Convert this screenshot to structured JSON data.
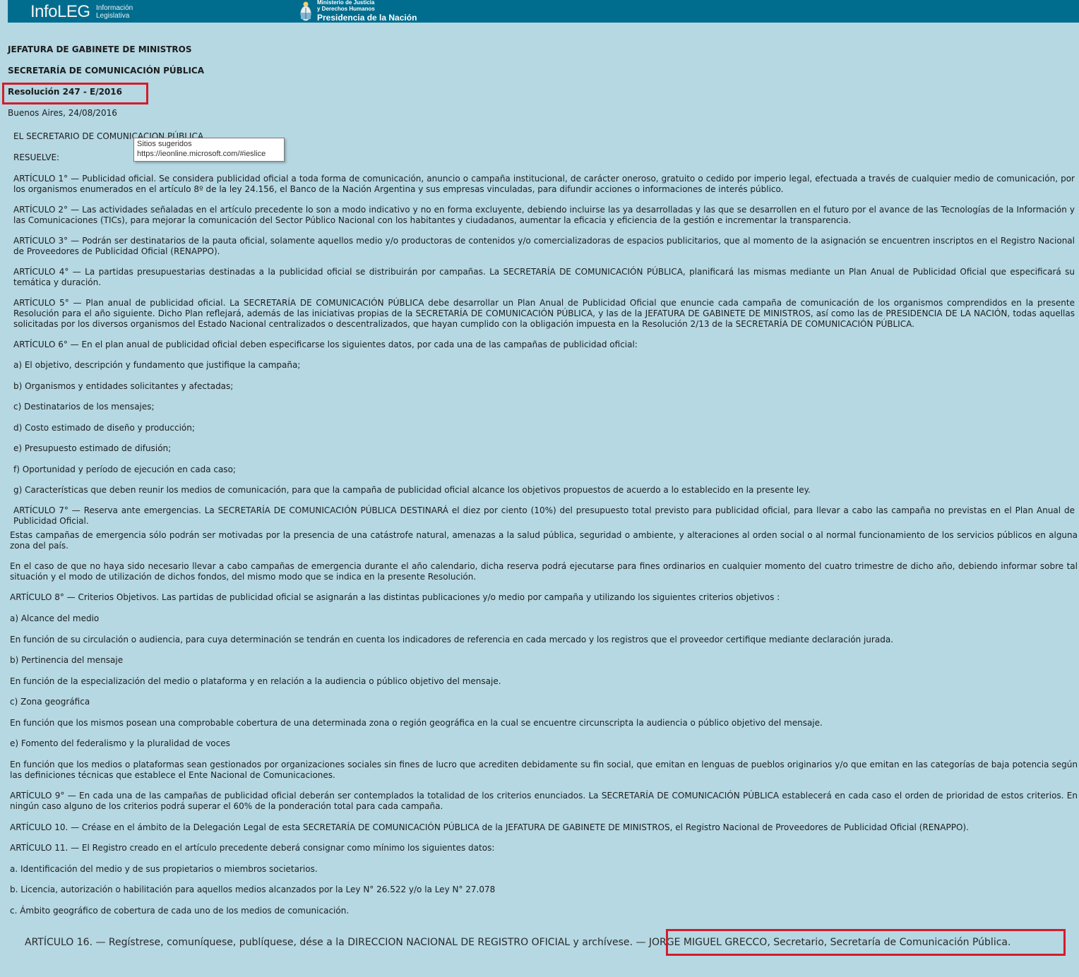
{
  "header": {
    "logo_main": "InfoLEG",
    "logo_sub_1": "Información",
    "logo_sub_2": "Legislativa",
    "ministry_1": "Ministerio de Justicia",
    "ministry_2": "y Derechos Humanos",
    "ministry_3": "Presidencia de la Nación",
    "bg_color": "#006d8f"
  },
  "doc": {
    "org1": "JEFATURA DE GABINETE DE MINISTROS",
    "org2": "SECRETARÍA DE COMUNICACIÓN PÚBLICA",
    "resolution": "Resolución 247 - E/2016",
    "place_date": "Buenos Aires, 24/08/2016",
    "lines": [
      "EL SECRETARIO DE COMUNICACION PÚBLICA",
      "RESUELVE:",
      "ARTÍCULO 1° — Publicidad oficial. Se considera publicidad oficial a toda forma de comunicación, anuncio o campaña institucional, de carácter oneroso, gratuito o cedido por imperio legal, efectuada a través de cualquier medio de comunicación, por los organismos enumerados en el artículo 8º de la ley 24.156, el Banco de la Nación Argentina y sus empresas vinculadas, para difundir acciones o informaciones de interés público.",
      "ARTÍCULO 2° — Las actividades señaladas en el artículo precedente lo son a modo indicativo y no en forma excluyente, debiendo incluirse las ya desarrolladas y las que se desarrollen en el futuro por el avance de las Tecnologías de la Información y las Comunicaciones (TICs), para mejorar la comunicación del Sector Público Nacional con los habitantes y ciudadanos, aumentar la eficacia y eficiencia de la gestión e incrementar la transparencia.",
      "ARTÍCULO 3° — Podrán ser destinatarios de la pauta oficial, solamente aquellos medio y/o productoras de contenidos y/o comercializadoras de espacios publicitarios, que al momento de la asignación se encuentren inscriptos en el Registro Nacional de Proveedores de Publicidad Oficial (RENAPPO).",
      "ARTÍCULO 4° — La partidas presupuestarias destinadas a la publicidad oficial se distribuirán por campañas. La SECRETARÍA DE COMUNICACIÓN PÚBLICA, planificará las mismas mediante un Plan Anual de Publicidad Oficial que especificará su temática y duración.",
      "ARTÍCULO 5° — Plan anual de publicidad oficial. La SECRETARÍA DE COMUNICACIÓN PÚBLICA debe desarrollar un Plan Anual de Publicidad Oficial que enuncie cada campaña de comunicación de los organismos comprendidos en la presente Resolución para el año siguiente. Dicho Plan reflejará, además de las iniciativas propias de la SECRETARÍA DE COMUNICACIÓN PÚBLICA, y las de la JEFATURA DE GABINETE DE MINISTROS, así como las de PRESIDENCIA DE LA NACIÓN, todas aquellas solicitadas por los diversos organismos del Estado Nacional centralizados o descentralizados, que hayan cumplido con la obligación impuesta en la Resolución 2/13 de la SECRETARÍA DE COMUNICACIÓN PÚBLICA.",
      "ARTÍCULO 6° — En el plan anual de publicidad oficial deben especificarse los siguientes datos, por cada una de las campañas de publicidad oficial:",
      "a) El objetivo, descripción y fundamento que justifique la campaña;",
      "b) Organismos y entidades solicitantes y afectadas;",
      "c) Destinatarios de los mensajes;",
      "d) Costo estimado de diseño y producción;",
      "e) Presupuesto estimado de difusión;",
      "f) Oportunidad y período de ejecución en cada caso;",
      "g) Características que deben reunir los medios de comunicación, para que la campaña de publicidad oficial alcance los objetivos propuestos de acuerdo a lo establecido en la presente ley.",
      "ARTÍCULO 7° — Reserva ante emergencias. La SECRETARÍA DE COMUNICACIÓN PÚBLICA DESTINARÁ el diez por ciento (10%) del presupuesto total previsto para publicidad oficial, para llevar a cabo las campaña no previstas en el Plan Anual de Publicidad Oficial.",
      "Estas campañas de emergencia sólo podrán ser motivadas por la presencia de una catástrofe natural, amenazas a la salud pública, seguridad o ambiente, y alteraciones al orden social o al normal funcionamiento de los servicios públicos en alguna zona del país.",
      "En el caso de que no haya sido necesario llevar a cabo campañas de emergencia durante el año calendario, dicha reserva podrá ejecutarse para fines ordinarios en cualquier momento del cuatro trimestre de dicho año, debiendo informar sobre tal situación y el modo de utilización de dichos fondos, del mismo modo que se indica en la presente Resolución.",
      "ARTÍCULO 8° — Criterios Objetivos. Las partidas de publicidad oficial se asignarán a las distintas publicaciones y/o medio por campaña y utilizando los siguientes criterios objetivos :",
      "a) Alcance del medio",
      "En función de su circulación o audiencia, para cuya determinación se tendrán en cuenta los indicadores de referencia en cada mercado y los registros que el proveedor certifique mediante declaración jurada.",
      "b) Pertinencia del mensaje",
      "En función de la especialización del medio o plataforma y en relación a la audiencia o público objetivo del mensaje.",
      "c) Zona geográfica",
      "En función que los mismos posean una comprobable cobertura de una determinada zona o región geográfica en la cual se encuentre circunscripta la audiencia o público objetivo del mensaje.",
      "e) Fomento del federalismo y la pluralidad de voces",
      "En función que los medios o plataformas sean gestionados por organizaciones sociales sin fines de lucro que acrediten debidamente su fin social, que emitan en lenguas de pueblos originarios y/o que emitan en las categorías de baja potencia según las definiciones técnicas que establece el Ente Nacional de Comunicaciones.",
      "ARTÍCULO 9° — En cada una de las campañas de publicidad oficial deberán ser contemplados la totalidad de los criterios enunciados. La SECRETARÍA DE COMUNICACIÓN PÚBLICA establecerá en cada caso el orden de prioridad de estos criterios. En ningún caso alguno de los criterios podrá superar el 60% de la ponderación total para cada campaña.",
      "ARTÍCULO 10. — Créase en el ámbito de la Delegación Legal de esta SECRETARÍA DE COMUNICACIÓN PÚBLICA de la JEFATURA DE GABINETE DE MINISTROS, el Registro Nacional de Proveedores de Publicidad Oficial (RENAPPO).",
      "ARTÍCULO 11. — El Registro creado en el artículo precedente deberá consignar como mínimo los siguientes datos:",
      "a. Identificación del medio y de sus propietarios o miembros societarios.",
      "b. Licencia, autorización o habilitación para aquellos medios alcanzados por la Ley N° 26.522 y/o la Ley N° 27.078",
      "c. Ámbito geográfico de cobertura de cada uno de los medios de comunicación."
    ],
    "footer_article": "ARTÍCULO 16. — Regístrese, comuníquese, publíquese, dése a la DIRECCION NACIONAL DE REGISTRO OFICIAL y archívese. —",
    "footer_signature": "JORGE MIGUEL GRECCO, Secretario, Secretaría de Comunicación Pública."
  },
  "tooltip": {
    "title": "Sitios sugeridos",
    "url": "https://ieonline.microsoft.com/#ieslice"
  },
  "highlight_color": "#d41c2b"
}
